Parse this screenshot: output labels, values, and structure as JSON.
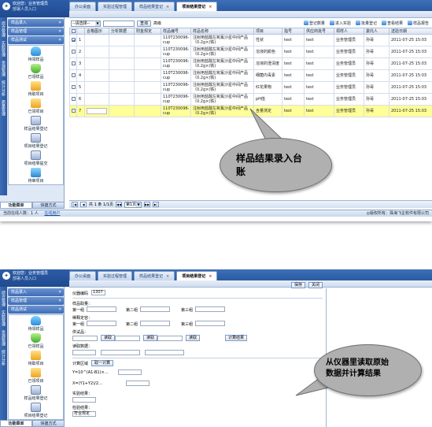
{
  "screen1": {
    "app": {
      "title_line1": "欢迎您：业务管理员",
      "title_line2": "部署人员入口"
    },
    "tabs": [
      {
        "label": "办公桌面"
      },
      {
        "label": "实验过程管理"
      },
      {
        "label": "样品结果登记",
        "close": "×"
      },
      {
        "label": "项目结果登记",
        "close": "×"
      }
    ],
    "vertical_tabs": [
      "综合管理",
      "实验管理",
      "资源管理",
      "统计分析",
      "质量管理"
    ],
    "menu_sections": [
      "样品录入",
      "样品管理",
      "样品测试"
    ],
    "menu_items": [
      "待领样品",
      "已领样品",
      "待取项目",
      "已领项目",
      "样品结果登记",
      "项目结果登记",
      "项目结果提交",
      "待审项目"
    ],
    "bottom_tabs": [
      "功能菜单",
      "快捷方式"
    ],
    "filter": {
      "select_value": "--请选择--",
      "search_label": "查询",
      "extra_label": "高级"
    },
    "toolbar": [
      {
        "label": "登记数量",
        "icon": "register-icon"
      },
      {
        "label": "进入实验",
        "icon": "enter-icon"
      },
      {
        "label": "批量登记",
        "icon": "batch-icon"
      },
      {
        "label": "查看结果",
        "icon": "view-icon"
      },
      {
        "label": "样品报告",
        "icon": "report-icon"
      }
    ],
    "table": {
      "headers": [
        "",
        "",
        "合格图示",
        "分析数据",
        "附金规定",
        "样品编号",
        "样品名称",
        "项目",
        "指号",
        "供应商批号",
        "领样人",
        "委托人",
        "送验日期"
      ],
      "rows": [
        {
          "n": "1",
          "checked": true,
          "sample_no": "110T230096-cup",
          "name": "注射用盐酸左氧氟沙星中间产品（0.2g×(铁)",
          "item": "性状",
          "code": "test",
          "batch": "test",
          "receiver": "业务管理员",
          "client": "孙哥",
          "date": "2011-07-25 15:03",
          "highlight": false
        },
        {
          "n": "2",
          "checked": false,
          "sample_no": "110T230096-cup",
          "name": "注射用盐酸左氧氟沙星中间产品（0.2g×(铁)",
          "item": "溶液的颜色",
          "code": "test",
          "batch": "test",
          "receiver": "业务管理员",
          "client": "孙哥",
          "date": "2011-07-25 15:03",
          "highlight": false
        },
        {
          "n": "3",
          "checked": false,
          "sample_no": "110T230096-cup",
          "name": "注射用盐酸左氧氟沙星中间产品（0.2g×(铁)",
          "item": "溶液的澄清度",
          "code": "test",
          "batch": "test",
          "receiver": "业务管理员",
          "client": "孙哥",
          "date": "2011-07-25 15:03",
          "highlight": false
        },
        {
          "n": "4",
          "checked": false,
          "sample_no": "110T230096-cup",
          "name": "注射用盐酸左氧氟沙星中间产品（0.2g×(铁)",
          "item": "细菌内毒素",
          "code": "test",
          "batch": "test",
          "receiver": "业务管理员",
          "client": "孙哥",
          "date": "2011-07-25 15:03",
          "highlight": false
        },
        {
          "n": "5",
          "checked": false,
          "sample_no": "110T230096-cup",
          "name": "注射用盐酸左氧氟沙星中间产品（0.2g×(铁)",
          "item": "红花果物",
          "code": "test",
          "batch": "test",
          "receiver": "业务管理员",
          "client": "孙哥",
          "date": "2011-07-25 15:03",
          "highlight": false
        },
        {
          "n": "6",
          "checked": false,
          "sample_no": "110T230096-cup",
          "name": "注射用盐酸左氧氟沙星中间产品（0.2g×(铁)",
          "item": "pH值",
          "code": "test",
          "batch": "test",
          "receiver": "业务管理员",
          "client": "孙哥",
          "date": "2011-07-25 15:03",
          "highlight": false
        },
        {
          "n": "7",
          "checked": false,
          "sample_no": "110T230096-cup",
          "name": "注射用盐酸左氧氟沙星中间产品（0.2g×(铁)",
          "item": "含量测定",
          "code": "test",
          "batch": "test",
          "receiver": "业务管理员",
          "client": "孙哥",
          "date": "2011-07-25 15:03",
          "highlight": true
        }
      ]
    },
    "pager": {
      "info": "共 1 条 1/1页",
      "page_select": "第1页"
    },
    "status": {
      "left": "当前在线人数：1 人",
      "link": "在线用户",
      "right": "◎版权所有：珠海飞企软件有限公司"
    },
    "callout": {
      "line1": "样品结果录入台",
      "line2": "账"
    }
  },
  "screen2": {
    "tabs": [
      {
        "label": "办公桌面"
      },
      {
        "label": "实验过程管理"
      },
      {
        "label": "样品结果登记",
        "close": "×"
      },
      {
        "label": "项目结果登记",
        "close": "×"
      }
    ],
    "buttons": {
      "save": "保存",
      "close": "关闭"
    },
    "form": {
      "sample_no_label": "仪器编码",
      "sample_no_value": "1307",
      "sample_weight_label": "样品取量：",
      "first_label": "第一组",
      "second_label": "第二组",
      "third_label": "第三组",
      "mass_label": "稀释定容：",
      "dilute_label": "供试品：",
      "read_btn": "读取",
      "calc_btn": "计算结果",
      "reading_label": "读取数据：",
      "result_area_label": "计算区域",
      "result_btn": "取一计算",
      "formula1": "Y=10^(A1-B1)×...",
      "formula2": "X=(Y1+Y2)/2...",
      "conclusion_label": "实验结果：",
      "final_label": "检验结果：",
      "final_value": "符合规定"
    },
    "callout": {
      "line1": "从仪器里读取原始",
      "line2": "数据并计算结果"
    }
  }
}
